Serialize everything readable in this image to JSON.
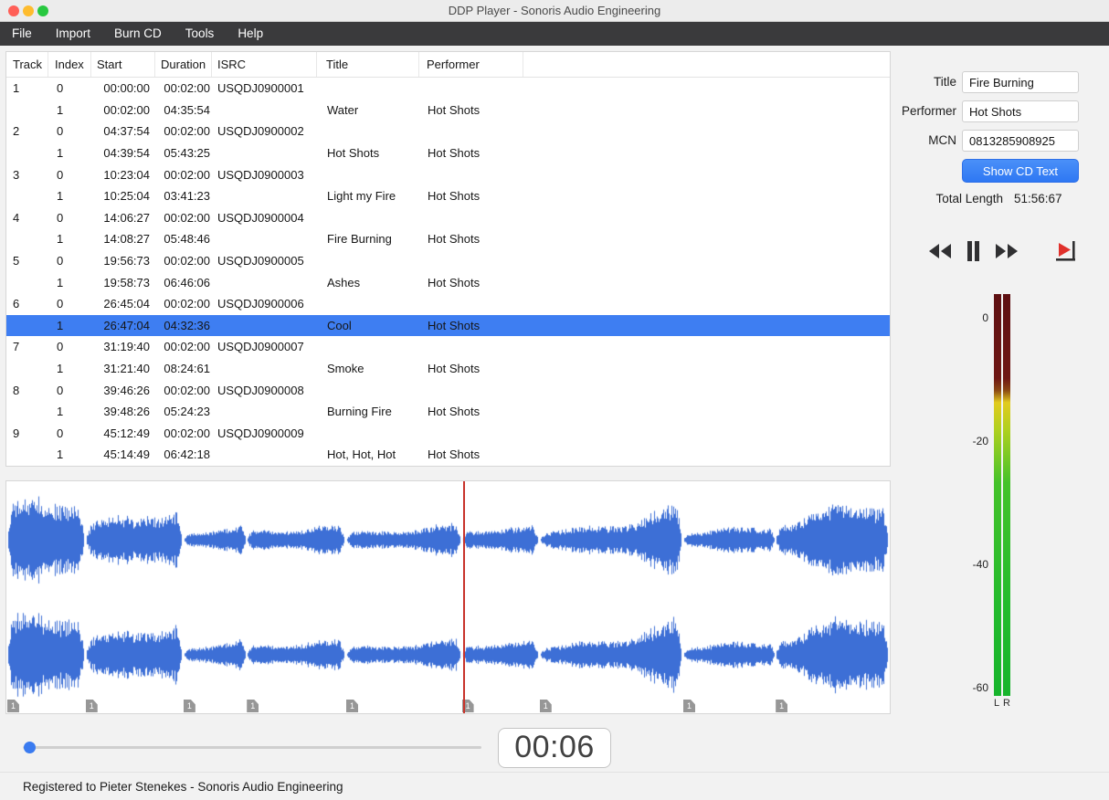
{
  "window": {
    "title": "DDP Player - Sonoris Audio Engineering",
    "menu": [
      "File",
      "Import",
      "Burn CD",
      "Tools",
      "Help"
    ],
    "status": "Registered to Pieter Stenekes - Sonoris Audio Engineering"
  },
  "table": {
    "columns": [
      "Track",
      "Index",
      "Start",
      "Duration",
      "ISRC",
      "Title",
      "Performer"
    ],
    "rows": [
      {
        "track": "1",
        "index": "0",
        "start": "00:00:00",
        "duration": "00:02:00",
        "isrc": "USQDJ0900001",
        "title": "",
        "performer": ""
      },
      {
        "track": "",
        "index": "1",
        "start": "00:02:00",
        "duration": "04:35:54",
        "isrc": "",
        "title": "Water",
        "performer": "Hot Shots"
      },
      {
        "track": "2",
        "index": "0",
        "start": "04:37:54",
        "duration": "00:02:00",
        "isrc": "USQDJ0900002",
        "title": "",
        "performer": ""
      },
      {
        "track": "",
        "index": "1",
        "start": "04:39:54",
        "duration": "05:43:25",
        "isrc": "",
        "title": "Hot Shots",
        "performer": "Hot Shots"
      },
      {
        "track": "3",
        "index": "0",
        "start": "10:23:04",
        "duration": "00:02:00",
        "isrc": "USQDJ0900003",
        "title": "",
        "performer": ""
      },
      {
        "track": "",
        "index": "1",
        "start": "10:25:04",
        "duration": "03:41:23",
        "isrc": "",
        "title": "Light my Fire",
        "performer": "Hot Shots"
      },
      {
        "track": "4",
        "index": "0",
        "start": "14:06:27",
        "duration": "00:02:00",
        "isrc": "USQDJ0900004",
        "title": "",
        "performer": ""
      },
      {
        "track": "",
        "index": "1",
        "start": "14:08:27",
        "duration": "05:48:46",
        "isrc": "",
        "title": "Fire Burning",
        "performer": "Hot Shots"
      },
      {
        "track": "5",
        "index": "0",
        "start": "19:56:73",
        "duration": "00:02:00",
        "isrc": "USQDJ0900005",
        "title": "",
        "performer": ""
      },
      {
        "track": "",
        "index": "1",
        "start": "19:58:73",
        "duration": "06:46:06",
        "isrc": "",
        "title": "Ashes",
        "performer": "Hot Shots"
      },
      {
        "track": "6",
        "index": "0",
        "start": "26:45:04",
        "duration": "00:02:00",
        "isrc": "USQDJ0900006",
        "title": "",
        "performer": ""
      },
      {
        "track": "",
        "index": "1",
        "start": "26:47:04",
        "duration": "04:32:36",
        "isrc": "",
        "title": "Cool",
        "performer": "Hot Shots",
        "selected": true
      },
      {
        "track": "7",
        "index": "0",
        "start": "31:19:40",
        "duration": "00:02:00",
        "isrc": "USQDJ0900007",
        "title": "",
        "performer": ""
      },
      {
        "track": "",
        "index": "1",
        "start": "31:21:40",
        "duration": "08:24:61",
        "isrc": "",
        "title": "Smoke",
        "performer": "Hot Shots"
      },
      {
        "track": "8",
        "index": "0",
        "start": "39:46:26",
        "duration": "00:02:00",
        "isrc": "USQDJ0900008",
        "title": "",
        "performer": ""
      },
      {
        "track": "",
        "index": "1",
        "start": "39:48:26",
        "duration": "05:24:23",
        "isrc": "",
        "title": "Burning Fire",
        "performer": "Hot Shots"
      },
      {
        "track": "9",
        "index": "0",
        "start": "45:12:49",
        "duration": "00:02:00",
        "isrc": "USQDJ0900009",
        "title": "",
        "performer": ""
      },
      {
        "track": "",
        "index": "1",
        "start": "45:14:49",
        "duration": "06:42:18",
        "isrc": "",
        "title": "Hot, Hot, Hot",
        "performer": "Hot Shots"
      }
    ]
  },
  "inspector": {
    "title_label": "Title",
    "title_value": "Fire Burning",
    "performer_label": "Performer",
    "performer_value": "Hot Shots",
    "mcn_label": "MCN",
    "mcn_value": "0813285908925",
    "show_cd_text": "Show CD Text",
    "total_length_label": "Total Length",
    "total_length_value": "51:56:67"
  },
  "transport": {
    "buttons": [
      "rewind-icon",
      "pause-icon",
      "fast-forward-icon",
      "play-to-marker-icon"
    ]
  },
  "meter": {
    "scale": [
      "0",
      "-20",
      "-40",
      "-60"
    ],
    "left_label": "L",
    "right_label": "R"
  },
  "player": {
    "time": "00:06",
    "slider": 0.014
  },
  "waveform": {
    "color": "#3d6fd6",
    "cursor_color": "#c8332b",
    "cursor": 0.5175,
    "marker_label": "1",
    "markers": [
      0.001,
      0.0897,
      0.2005,
      0.2722,
      0.3847,
      0.5156,
      0.6037,
      0.7663,
      0.8709
    ],
    "segments": [
      {
        "start": 0.001,
        "end": 0.0891
      },
      {
        "start": 0.0897,
        "end": 0.1999
      },
      {
        "start": 0.2005,
        "end": 0.2716
      },
      {
        "start": 0.2722,
        "end": 0.384
      },
      {
        "start": 0.3847,
        "end": 0.5149
      },
      {
        "start": 0.5156,
        "end": 0.603
      },
      {
        "start": 0.6037,
        "end": 0.7656
      },
      {
        "start": 0.7663,
        "end": 0.8703
      },
      {
        "start": 0.8709,
        "end": 0.999
      }
    ]
  },
  "colors": {
    "selection": "#3e7ef2",
    "accent_button": "#3b86f8"
  }
}
